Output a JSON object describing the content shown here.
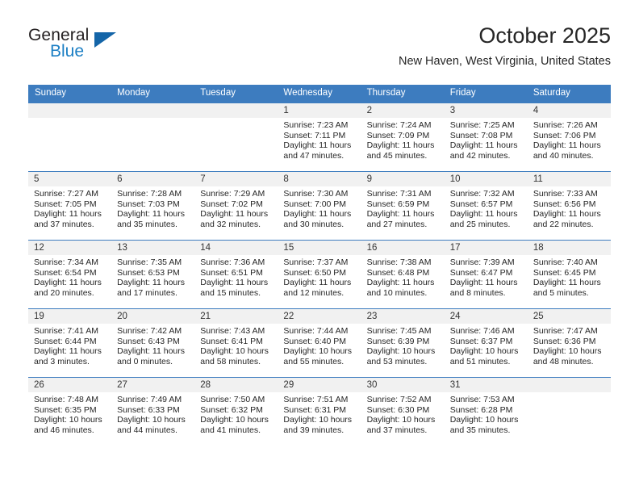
{
  "logo": {
    "word_top": "General",
    "word_bottom": "Blue",
    "triangle_icon": "blue-triangle-icon",
    "color_dark": "#231f20",
    "color_blue": "#1c7fc4"
  },
  "header": {
    "title": "October 2025",
    "subtitle": "New Haven, West Virginia, United States"
  },
  "theme": {
    "header_blue": "#3d7cbf",
    "daynum_band": "#f1f1f1",
    "text": "#262626"
  },
  "calendar": {
    "weekday_headers": [
      "Sunday",
      "Monday",
      "Tuesday",
      "Wednesday",
      "Thursday",
      "Friday",
      "Saturday"
    ],
    "labels": {
      "sunrise": "Sunrise:",
      "sunset": "Sunset:",
      "daylight": "Daylight:"
    },
    "weeks": [
      [
        {
          "day": "",
          "empty": true,
          "sunrise": "",
          "sunset": "",
          "daylight_line1": "",
          "daylight_line2": ""
        },
        {
          "day": "",
          "empty": true,
          "sunrise": "",
          "sunset": "",
          "daylight_line1": "",
          "daylight_line2": ""
        },
        {
          "day": "",
          "empty": true,
          "sunrise": "",
          "sunset": "",
          "daylight_line1": "",
          "daylight_line2": ""
        },
        {
          "day": "1",
          "empty": false,
          "sunrise": "Sunrise: 7:23 AM",
          "sunset": "Sunset: 7:11 PM",
          "daylight_line1": "Daylight: 11 hours",
          "daylight_line2": "and 47 minutes."
        },
        {
          "day": "2",
          "empty": false,
          "sunrise": "Sunrise: 7:24 AM",
          "sunset": "Sunset: 7:09 PM",
          "daylight_line1": "Daylight: 11 hours",
          "daylight_line2": "and 45 minutes."
        },
        {
          "day": "3",
          "empty": false,
          "sunrise": "Sunrise: 7:25 AM",
          "sunset": "Sunset: 7:08 PM",
          "daylight_line1": "Daylight: 11 hours",
          "daylight_line2": "and 42 minutes."
        },
        {
          "day": "4",
          "empty": false,
          "sunrise": "Sunrise: 7:26 AM",
          "sunset": "Sunset: 7:06 PM",
          "daylight_line1": "Daylight: 11 hours",
          "daylight_line2": "and 40 minutes."
        }
      ],
      [
        {
          "day": "5",
          "empty": false,
          "sunrise": "Sunrise: 7:27 AM",
          "sunset": "Sunset: 7:05 PM",
          "daylight_line1": "Daylight: 11 hours",
          "daylight_line2": "and 37 minutes."
        },
        {
          "day": "6",
          "empty": false,
          "sunrise": "Sunrise: 7:28 AM",
          "sunset": "Sunset: 7:03 PM",
          "daylight_line1": "Daylight: 11 hours",
          "daylight_line2": "and 35 minutes."
        },
        {
          "day": "7",
          "empty": false,
          "sunrise": "Sunrise: 7:29 AM",
          "sunset": "Sunset: 7:02 PM",
          "daylight_line1": "Daylight: 11 hours",
          "daylight_line2": "and 32 minutes."
        },
        {
          "day": "8",
          "empty": false,
          "sunrise": "Sunrise: 7:30 AM",
          "sunset": "Sunset: 7:00 PM",
          "daylight_line1": "Daylight: 11 hours",
          "daylight_line2": "and 30 minutes."
        },
        {
          "day": "9",
          "empty": false,
          "sunrise": "Sunrise: 7:31 AM",
          "sunset": "Sunset: 6:59 PM",
          "daylight_line1": "Daylight: 11 hours",
          "daylight_line2": "and 27 minutes."
        },
        {
          "day": "10",
          "empty": false,
          "sunrise": "Sunrise: 7:32 AM",
          "sunset": "Sunset: 6:57 PM",
          "daylight_line1": "Daylight: 11 hours",
          "daylight_line2": "and 25 minutes."
        },
        {
          "day": "11",
          "empty": false,
          "sunrise": "Sunrise: 7:33 AM",
          "sunset": "Sunset: 6:56 PM",
          "daylight_line1": "Daylight: 11 hours",
          "daylight_line2": "and 22 minutes."
        }
      ],
      [
        {
          "day": "12",
          "empty": false,
          "sunrise": "Sunrise: 7:34 AM",
          "sunset": "Sunset: 6:54 PM",
          "daylight_line1": "Daylight: 11 hours",
          "daylight_line2": "and 20 minutes."
        },
        {
          "day": "13",
          "empty": false,
          "sunrise": "Sunrise: 7:35 AM",
          "sunset": "Sunset: 6:53 PM",
          "daylight_line1": "Daylight: 11 hours",
          "daylight_line2": "and 17 minutes."
        },
        {
          "day": "14",
          "empty": false,
          "sunrise": "Sunrise: 7:36 AM",
          "sunset": "Sunset: 6:51 PM",
          "daylight_line1": "Daylight: 11 hours",
          "daylight_line2": "and 15 minutes."
        },
        {
          "day": "15",
          "empty": false,
          "sunrise": "Sunrise: 7:37 AM",
          "sunset": "Sunset: 6:50 PM",
          "daylight_line1": "Daylight: 11 hours",
          "daylight_line2": "and 12 minutes."
        },
        {
          "day": "16",
          "empty": false,
          "sunrise": "Sunrise: 7:38 AM",
          "sunset": "Sunset: 6:48 PM",
          "daylight_line1": "Daylight: 11 hours",
          "daylight_line2": "and 10 minutes."
        },
        {
          "day": "17",
          "empty": false,
          "sunrise": "Sunrise: 7:39 AM",
          "sunset": "Sunset: 6:47 PM",
          "daylight_line1": "Daylight: 11 hours",
          "daylight_line2": "and 8 minutes."
        },
        {
          "day": "18",
          "empty": false,
          "sunrise": "Sunrise: 7:40 AM",
          "sunset": "Sunset: 6:45 PM",
          "daylight_line1": "Daylight: 11 hours",
          "daylight_line2": "and 5 minutes."
        }
      ],
      [
        {
          "day": "19",
          "empty": false,
          "sunrise": "Sunrise: 7:41 AM",
          "sunset": "Sunset: 6:44 PM",
          "daylight_line1": "Daylight: 11 hours",
          "daylight_line2": "and 3 minutes."
        },
        {
          "day": "20",
          "empty": false,
          "sunrise": "Sunrise: 7:42 AM",
          "sunset": "Sunset: 6:43 PM",
          "daylight_line1": "Daylight: 11 hours",
          "daylight_line2": "and 0 minutes."
        },
        {
          "day": "21",
          "empty": false,
          "sunrise": "Sunrise: 7:43 AM",
          "sunset": "Sunset: 6:41 PM",
          "daylight_line1": "Daylight: 10 hours",
          "daylight_line2": "and 58 minutes."
        },
        {
          "day": "22",
          "empty": false,
          "sunrise": "Sunrise: 7:44 AM",
          "sunset": "Sunset: 6:40 PM",
          "daylight_line1": "Daylight: 10 hours",
          "daylight_line2": "and 55 minutes."
        },
        {
          "day": "23",
          "empty": false,
          "sunrise": "Sunrise: 7:45 AM",
          "sunset": "Sunset: 6:39 PM",
          "daylight_line1": "Daylight: 10 hours",
          "daylight_line2": "and 53 minutes."
        },
        {
          "day": "24",
          "empty": false,
          "sunrise": "Sunrise: 7:46 AM",
          "sunset": "Sunset: 6:37 PM",
          "daylight_line1": "Daylight: 10 hours",
          "daylight_line2": "and 51 minutes."
        },
        {
          "day": "25",
          "empty": false,
          "sunrise": "Sunrise: 7:47 AM",
          "sunset": "Sunset: 6:36 PM",
          "daylight_line1": "Daylight: 10 hours",
          "daylight_line2": "and 48 minutes."
        }
      ],
      [
        {
          "day": "26",
          "empty": false,
          "sunrise": "Sunrise: 7:48 AM",
          "sunset": "Sunset: 6:35 PM",
          "daylight_line1": "Daylight: 10 hours",
          "daylight_line2": "and 46 minutes."
        },
        {
          "day": "27",
          "empty": false,
          "sunrise": "Sunrise: 7:49 AM",
          "sunset": "Sunset: 6:33 PM",
          "daylight_line1": "Daylight: 10 hours",
          "daylight_line2": "and 44 minutes."
        },
        {
          "day": "28",
          "empty": false,
          "sunrise": "Sunrise: 7:50 AM",
          "sunset": "Sunset: 6:32 PM",
          "daylight_line1": "Daylight: 10 hours",
          "daylight_line2": "and 41 minutes."
        },
        {
          "day": "29",
          "empty": false,
          "sunrise": "Sunrise: 7:51 AM",
          "sunset": "Sunset: 6:31 PM",
          "daylight_line1": "Daylight: 10 hours",
          "daylight_line2": "and 39 minutes."
        },
        {
          "day": "30",
          "empty": false,
          "sunrise": "Sunrise: 7:52 AM",
          "sunset": "Sunset: 6:30 PM",
          "daylight_line1": "Daylight: 10 hours",
          "daylight_line2": "and 37 minutes."
        },
        {
          "day": "31",
          "empty": false,
          "sunrise": "Sunrise: 7:53 AM",
          "sunset": "Sunset: 6:28 PM",
          "daylight_line1": "Daylight: 10 hours",
          "daylight_line2": "and 35 minutes."
        },
        {
          "day": "",
          "empty": true,
          "sunrise": "",
          "sunset": "",
          "daylight_line1": "",
          "daylight_line2": ""
        }
      ]
    ]
  }
}
